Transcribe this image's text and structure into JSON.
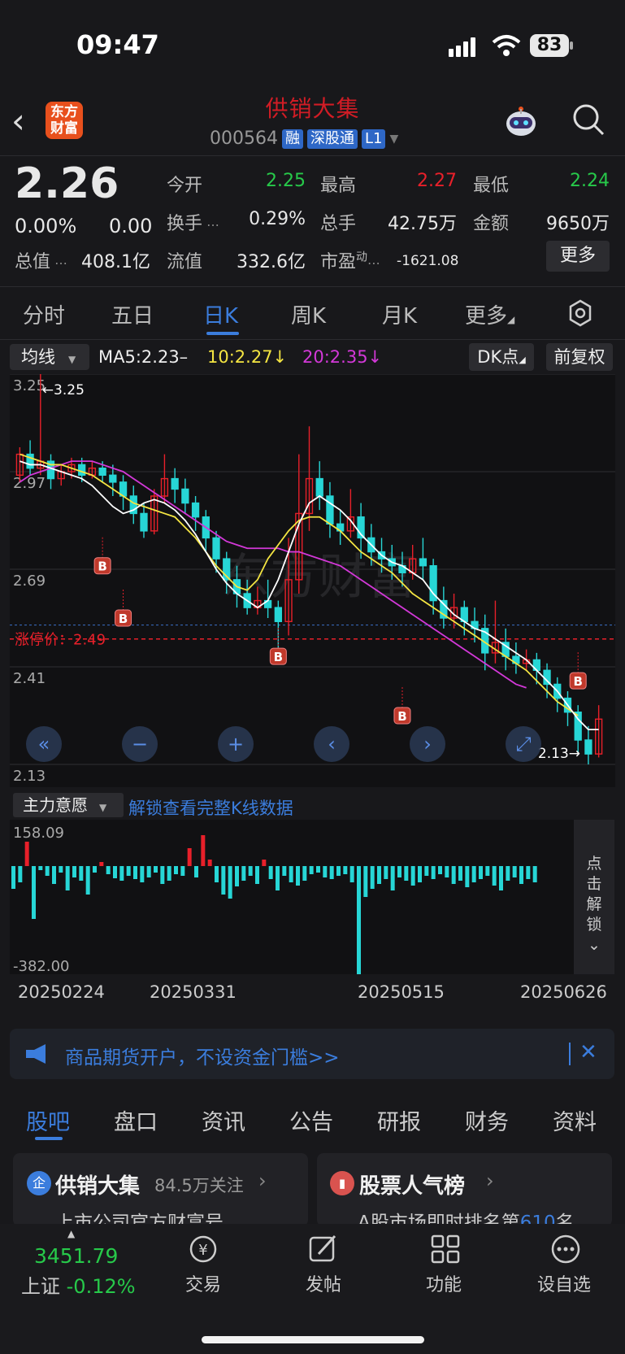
{
  "status": {
    "time": "09:47",
    "battery": "83"
  },
  "header": {
    "logo_line1": "东方",
    "logo_line2": "财富",
    "stock_name": "供销大集",
    "code": "000564",
    "tags": [
      "融",
      "深股通",
      "L1"
    ]
  },
  "quote": {
    "price": "2.26",
    "change_pct": "0.00%",
    "change": "0.00",
    "zongzhi_label": "总值",
    "zongzhi": "408.1亿",
    "jinkai_label": "今开",
    "jinkai": "2.25",
    "zuigao_label": "最高",
    "zuigao": "2.27",
    "zuidi_label": "最低",
    "zuidi": "2.24",
    "huanshou_label": "换手",
    "huanshou": "0.29%",
    "zongshou_label": "总手",
    "zongshou": "42.75万",
    "jine_label": "金额",
    "jine": "9650万",
    "liuzhi_label": "流值",
    "liuzhi": "332.6亿",
    "shiying_label": "市盈",
    "shiying_sup": "动",
    "shiying": "-1621.08",
    "more_btn": "更多"
  },
  "tabs": [
    "分时",
    "五日",
    "日K",
    "周K",
    "月K",
    "更多"
  ],
  "ma": {
    "select": "均线",
    "ma5": "MA5:2.23–",
    "ma10": "10:2.27↓",
    "ma20": "20:2.35↓",
    "dk_btn": "DK点",
    "fq_btn": "前复权"
  },
  "chart_data": {
    "type": "candlestick",
    "y_ticks": [
      "3.25",
      "2.97",
      "2.69",
      "2.41",
      "2.13"
    ],
    "ylim": [
      2.13,
      3.25
    ],
    "annotations": {
      "high": "←3.25",
      "low": "2.13→",
      "limit_label": "涨停价：",
      "limit_value": "2.49"
    },
    "signal_marker": "B",
    "x_dates": [
      "20250224",
      "20250331",
      "20250515",
      "20250626"
    ],
    "candles": [
      [
        2.96,
        3.02,
        3.04,
        2.94
      ],
      [
        3.02,
        2.98,
        3.06,
        2.96
      ],
      [
        2.98,
        3.0,
        3.25,
        2.96
      ],
      [
        3.0,
        2.95,
        3.02,
        2.92
      ],
      [
        2.95,
        2.97,
        2.99,
        2.93
      ],
      [
        2.97,
        2.99,
        3.01,
        2.95
      ],
      [
        2.99,
        2.96,
        3.01,
        2.94
      ],
      [
        2.96,
        2.98,
        3.0,
        2.95
      ],
      [
        2.98,
        2.96,
        3.0,
        2.94
      ],
      [
        2.96,
        2.94,
        2.99,
        2.9
      ],
      [
        2.94,
        2.9,
        2.96,
        2.86
      ],
      [
        2.9,
        2.85,
        2.93,
        2.82
      ],
      [
        2.85,
        2.8,
        2.88,
        2.78
      ],
      [
        2.8,
        2.9,
        2.92,
        2.79
      ],
      [
        2.9,
        2.95,
        3.02,
        2.88
      ],
      [
        2.95,
        2.92,
        2.98,
        2.88
      ],
      [
        2.92,
        2.88,
        2.95,
        2.85
      ],
      [
        2.88,
        2.84,
        2.9,
        2.8
      ],
      [
        2.84,
        2.78,
        2.86,
        2.74
      ],
      [
        2.78,
        2.72,
        2.8,
        2.68
      ],
      [
        2.72,
        2.66,
        2.74,
        2.62
      ],
      [
        2.66,
        2.62,
        2.7,
        2.58
      ],
      [
        2.62,
        2.58,
        2.66,
        2.56
      ],
      [
        2.58,
        2.6,
        2.64,
        2.56
      ],
      [
        2.6,
        2.58,
        2.66,
        2.55
      ],
      [
        2.58,
        2.54,
        2.6,
        2.43
      ],
      [
        2.54,
        2.66,
        2.78,
        2.5
      ],
      [
        2.66,
        2.85,
        3.02,
        2.62
      ],
      [
        2.85,
        2.95,
        3.1,
        2.8
      ],
      [
        2.95,
        2.9,
        3.0,
        2.86
      ],
      [
        2.9,
        2.82,
        2.94,
        2.78
      ],
      [
        2.82,
        2.8,
        2.86,
        2.76
      ],
      [
        2.8,
        2.84,
        2.92,
        2.78
      ],
      [
        2.84,
        2.78,
        2.88,
        2.72
      ],
      [
        2.78,
        2.74,
        2.82,
        2.7
      ],
      [
        2.74,
        2.72,
        2.78,
        2.68
      ],
      [
        2.72,
        2.7,
        2.76,
        2.66
      ],
      [
        2.7,
        2.68,
        2.74,
        2.64
      ],
      [
        2.68,
        2.72,
        2.76,
        2.66
      ],
      [
        2.72,
        2.7,
        2.78,
        2.66
      ],
      [
        2.7,
        2.6,
        2.72,
        2.56
      ],
      [
        2.6,
        2.55,
        2.64,
        2.52
      ],
      [
        2.55,
        2.58,
        2.62,
        2.52
      ],
      [
        2.58,
        2.54,
        2.6,
        2.5
      ],
      [
        2.54,
        2.52,
        2.58,
        2.48
      ],
      [
        2.52,
        2.45,
        2.56,
        2.4
      ],
      [
        2.45,
        2.48,
        2.6,
        2.42
      ],
      [
        2.48,
        2.44,
        2.52,
        2.4
      ],
      [
        2.44,
        2.42,
        2.48,
        2.39
      ],
      [
        2.42,
        2.43,
        2.46,
        2.4
      ],
      [
        2.43,
        2.4,
        2.45,
        2.36
      ],
      [
        2.4,
        2.36,
        2.42,
        2.32
      ],
      [
        2.36,
        2.32,
        2.38,
        2.28
      ],
      [
        2.32,
        2.28,
        2.34,
        2.24
      ],
      [
        2.28,
        2.2,
        2.3,
        2.16
      ],
      [
        2.2,
        2.16,
        2.24,
        2.13
      ],
      [
        2.16,
        2.26,
        2.3,
        2.15
      ]
    ],
    "ma5": [
      3.0,
      2.99,
      2.99,
      2.98,
      2.97,
      2.96,
      2.95,
      2.93,
      2.9,
      2.87,
      2.85,
      2.86,
      2.88,
      2.89,
      2.88,
      2.86,
      2.83,
      2.79,
      2.74,
      2.69,
      2.65,
      2.62,
      2.6,
      2.58,
      2.6,
      2.66,
      2.74,
      2.82,
      2.88,
      2.9,
      2.88,
      2.86,
      2.83,
      2.79,
      2.76,
      2.73,
      2.71,
      2.7,
      2.68,
      2.66,
      2.62,
      2.59,
      2.56,
      2.54,
      2.52,
      2.51,
      2.49,
      2.47,
      2.45,
      2.43,
      2.4,
      2.37,
      2.34,
      2.3,
      2.26,
      2.23,
      2.23
    ],
    "ma10": [
      3.02,
      3.01,
      3.0,
      2.99,
      2.99,
      2.98,
      2.97,
      2.96,
      2.94,
      2.92,
      2.9,
      2.88,
      2.87,
      2.86,
      2.85,
      2.84,
      2.81,
      2.78,
      2.74,
      2.7,
      2.67,
      2.64,
      2.63,
      2.66,
      2.72,
      2.76,
      2.8,
      2.83,
      2.84,
      2.84,
      2.82,
      2.8,
      2.77,
      2.74,
      2.72,
      2.7,
      2.68,
      2.65,
      2.62,
      2.6,
      2.58,
      2.56,
      2.54,
      2.52,
      2.5,
      2.48,
      2.46,
      2.44,
      2.42,
      2.4,
      2.37,
      2.34,
      2.31,
      2.29,
      2.27
    ],
    "ma20": [
      2.94,
      2.96,
      2.97,
      2.98,
      2.99,
      3.0,
      3.0,
      3.0,
      2.99,
      2.98,
      2.97,
      2.95,
      2.93,
      2.91,
      2.89,
      2.87,
      2.85,
      2.83,
      2.81,
      2.79,
      2.77,
      2.76,
      2.75,
      2.75,
      2.75,
      2.75,
      2.74,
      2.74,
      2.73,
      2.72,
      2.71,
      2.7,
      2.68,
      2.66,
      2.64,
      2.62,
      2.6,
      2.58,
      2.56,
      2.54,
      2.52,
      2.5,
      2.48,
      2.46,
      2.44,
      2.42,
      2.4,
      2.38,
      2.36,
      2.35
    ]
  },
  "indicator": {
    "select": "主力意愿",
    "unlock_text": "解锁查看完整K线数据",
    "top": "158.09",
    "bottom": "-382.00",
    "side": [
      "点",
      "击",
      "解",
      "锁"
    ]
  },
  "ad": {
    "text": "商品期货开户，不设资金门槛>>"
  },
  "btabs": [
    "股吧",
    "盘口",
    "资讯",
    "公告",
    "研报",
    "财务",
    "资料"
  ],
  "cards": [
    {
      "title": "供销大集",
      "badge": "84.5万关注",
      "sub": "上市公司官方财富号"
    },
    {
      "title": "股票人气榜",
      "sub_pre": "A股市场即时排名第",
      "rank": "610",
      "sub_post": "名"
    }
  ],
  "bottom": {
    "index_value": "3451.79",
    "index_name": "上证",
    "index_chg": "-0.12%",
    "nav": [
      "交易",
      "发帖",
      "功能",
      "设自选"
    ]
  }
}
